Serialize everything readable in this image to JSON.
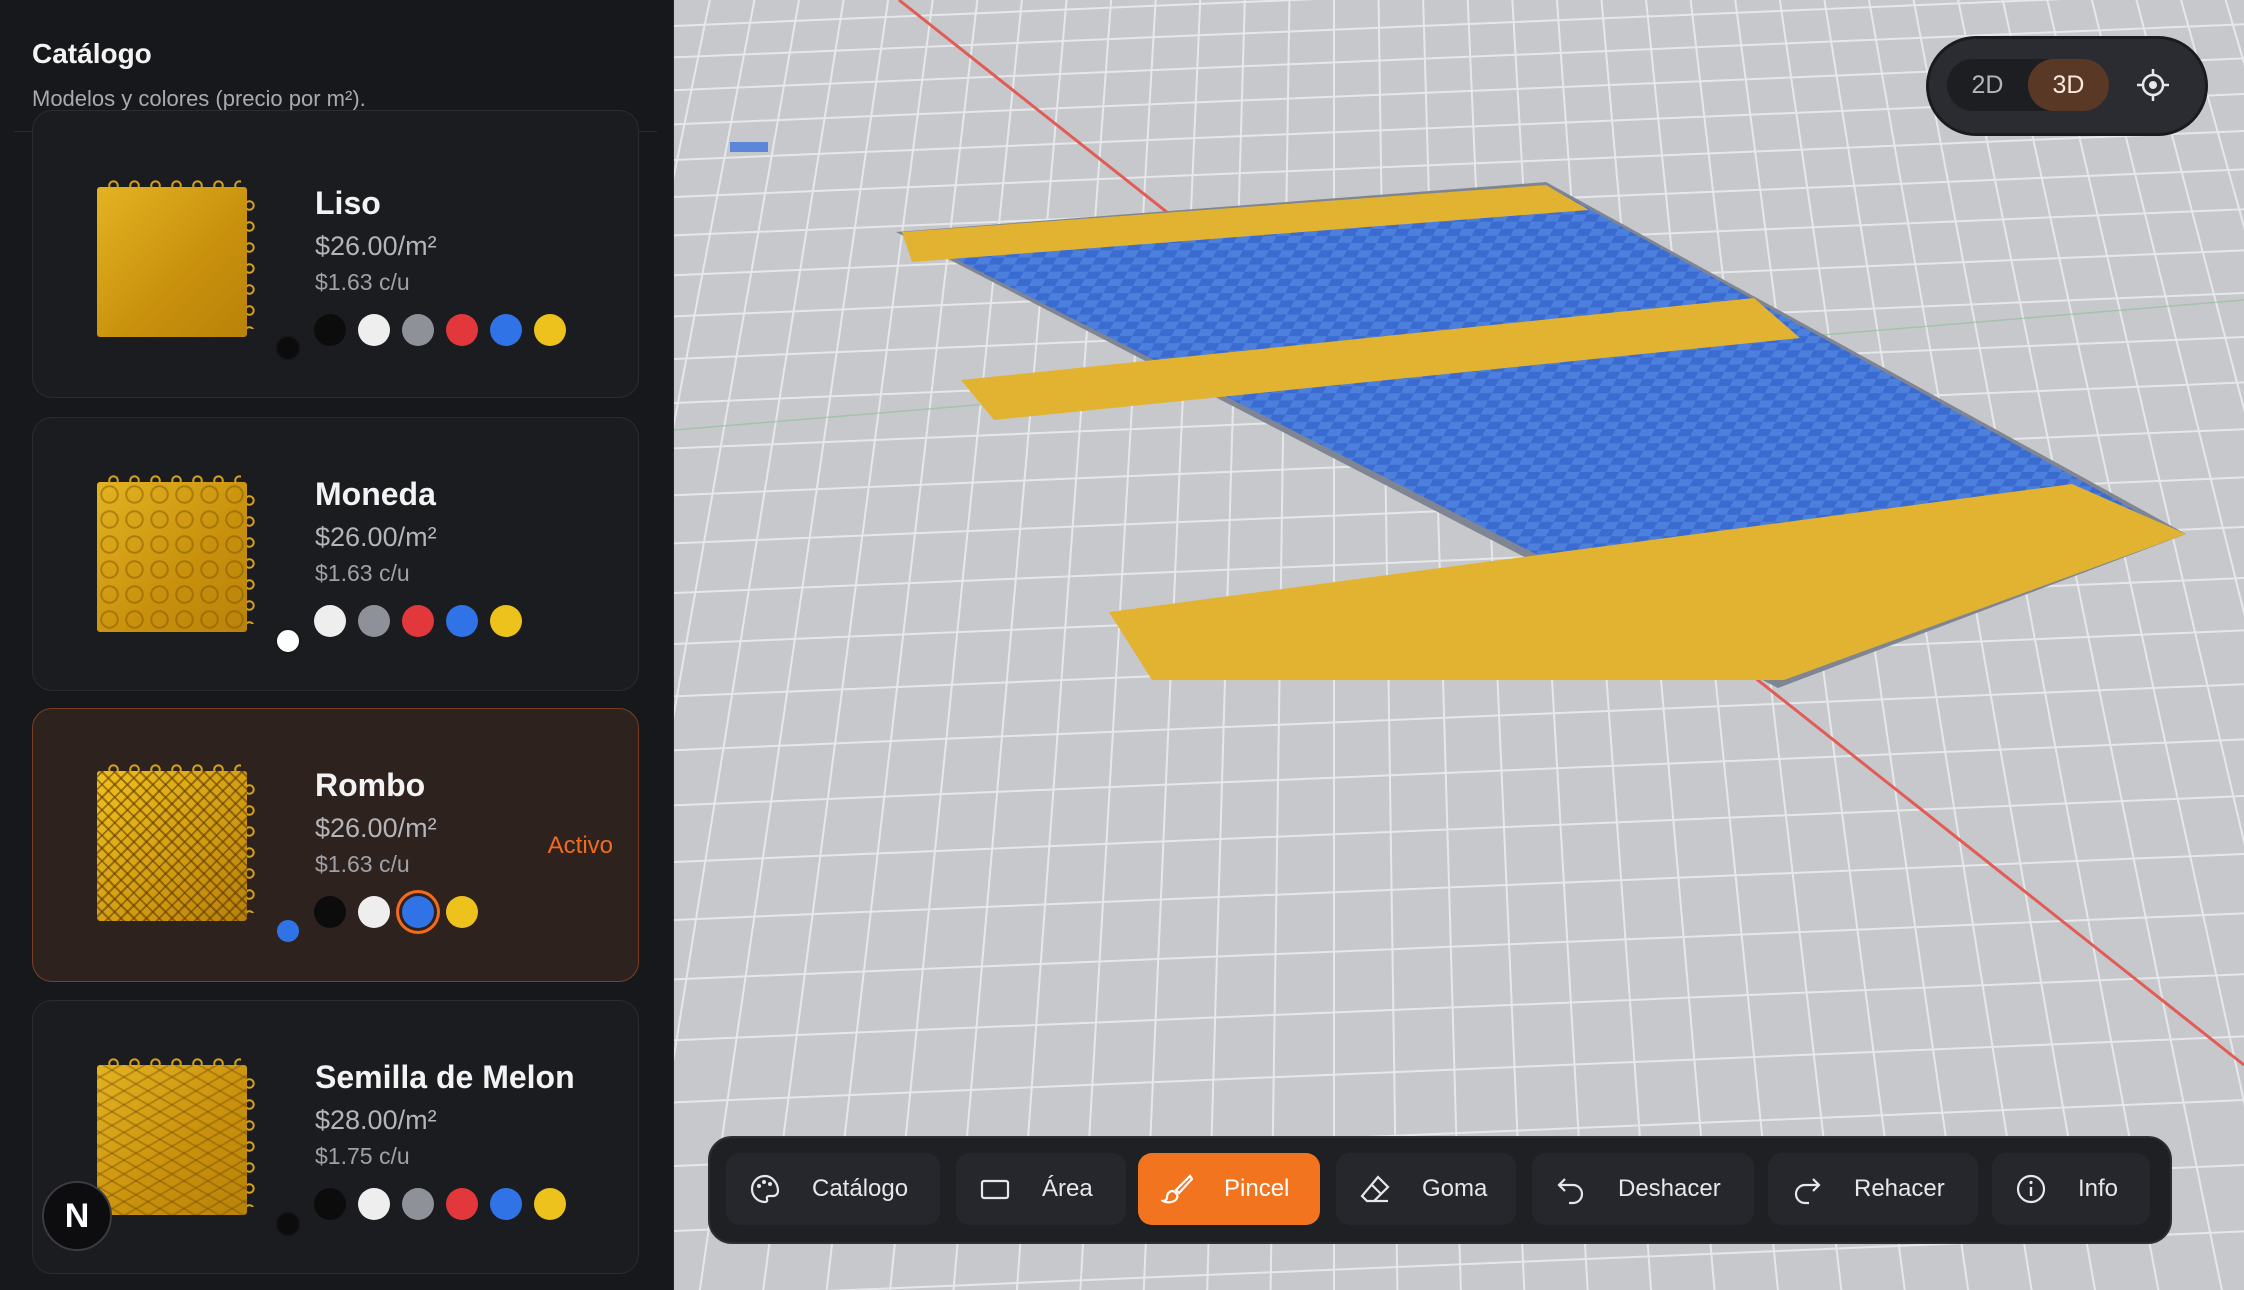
{
  "sidebar": {
    "title": "Catálogo",
    "subtitle": "Modelos y colores (precio por m²).",
    "items": [
      {
        "name": "Liso",
        "price": "$26.00/m²",
        "unit_price": "$1.63 c/u",
        "selected_color": "#0c0c0d",
        "colors": [
          "#0c0c0d",
          "#eeeeee",
          "#8f9198",
          "#e3383b",
          "#2f73e6",
          "#eec21c"
        ]
      },
      {
        "name": "Moneda",
        "price": "$26.00/m²",
        "unit_price": "$1.63 c/u",
        "selected_color": "#ffffff",
        "colors": [
          "#eeeeee",
          "#8f9198",
          "#e3383b",
          "#2f73e6",
          "#eec21c"
        ]
      },
      {
        "name": "Rombo",
        "price": "$26.00/m²",
        "unit_price": "$1.63 c/u",
        "status": "Activo",
        "selected_color": "#2f73e6",
        "colors": [
          "#0c0c0d",
          "#eeeeee",
          "#2f73e6",
          "#eec21c"
        ]
      },
      {
        "name": "Semilla de Melon",
        "price": "$28.00/m²",
        "unit_price": "$1.75 c/u",
        "selected_color": "#0c0c0d",
        "colors": [
          "#0c0c0d",
          "#eeeeee",
          "#8f9198",
          "#e3383b",
          "#2f73e6",
          "#eec21c"
        ]
      }
    ],
    "badge": "N"
  },
  "view_toggle": {
    "options": [
      "2D",
      "3D"
    ],
    "active": "3D",
    "locate_icon": "crosshair-icon"
  },
  "toolbar": {
    "active": "Pincel",
    "buttons": [
      {
        "label": "Catálogo",
        "icon": "palette-icon"
      },
      {
        "label": "Área",
        "icon": "rectangle-icon"
      },
      {
        "label": "Pincel",
        "icon": "brush-icon"
      },
      {
        "label": "Goma",
        "icon": "eraser-icon"
      },
      {
        "label": "Deshacer",
        "icon": "undo-icon"
      },
      {
        "label": "Rehacer",
        "icon": "redo-icon"
      },
      {
        "label": "Info",
        "icon": "info-icon"
      }
    ]
  },
  "scene": {
    "floor_colors": {
      "stripe": "#e2b231",
      "field": "#3a6bd0",
      "edge": "#7f8592"
    },
    "grid_color": "#e6e7ea",
    "axis_color": "#e25c55"
  }
}
